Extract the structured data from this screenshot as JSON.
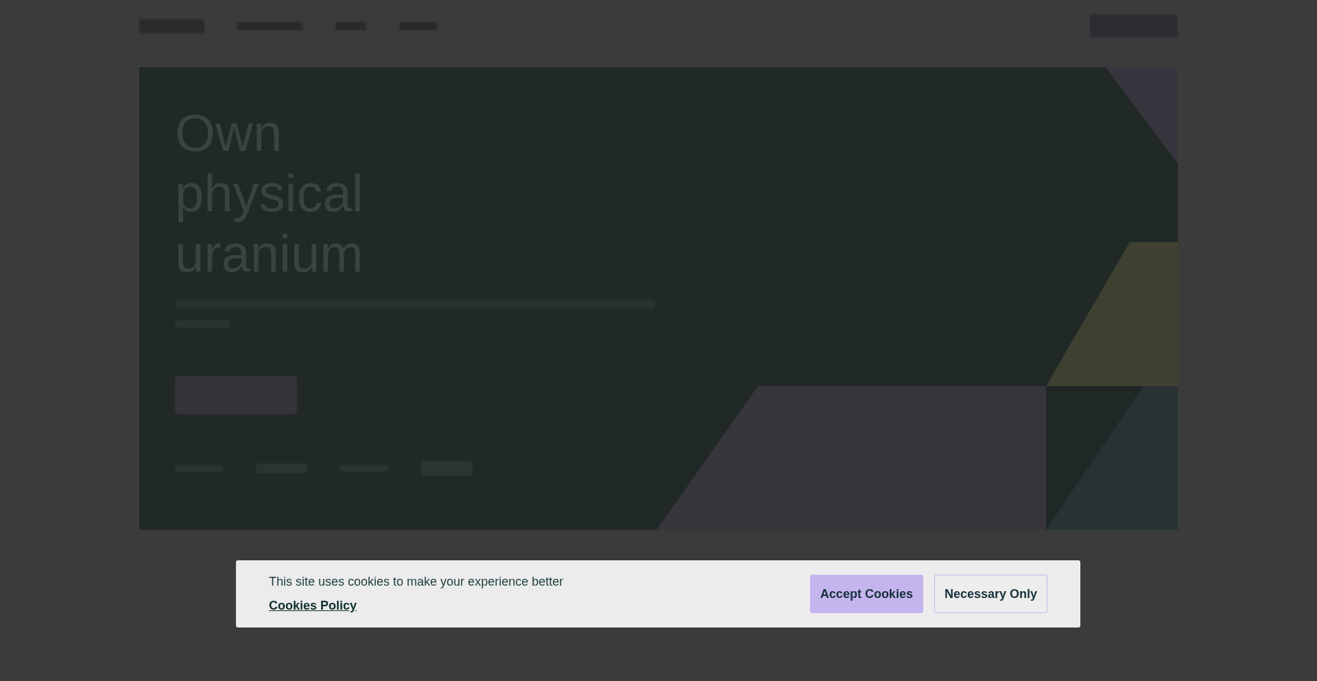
{
  "hero": {
    "heading": "Own physical uranium"
  },
  "cookie_banner": {
    "message": "This site uses cookies to make your experience better",
    "policy_link": "Cookies Policy",
    "buttons": [
      {
        "label": "Accept Cookies",
        "kind": "primary"
      },
      {
        "label": "Necessary Only",
        "kind": "outline"
      }
    ]
  }
}
